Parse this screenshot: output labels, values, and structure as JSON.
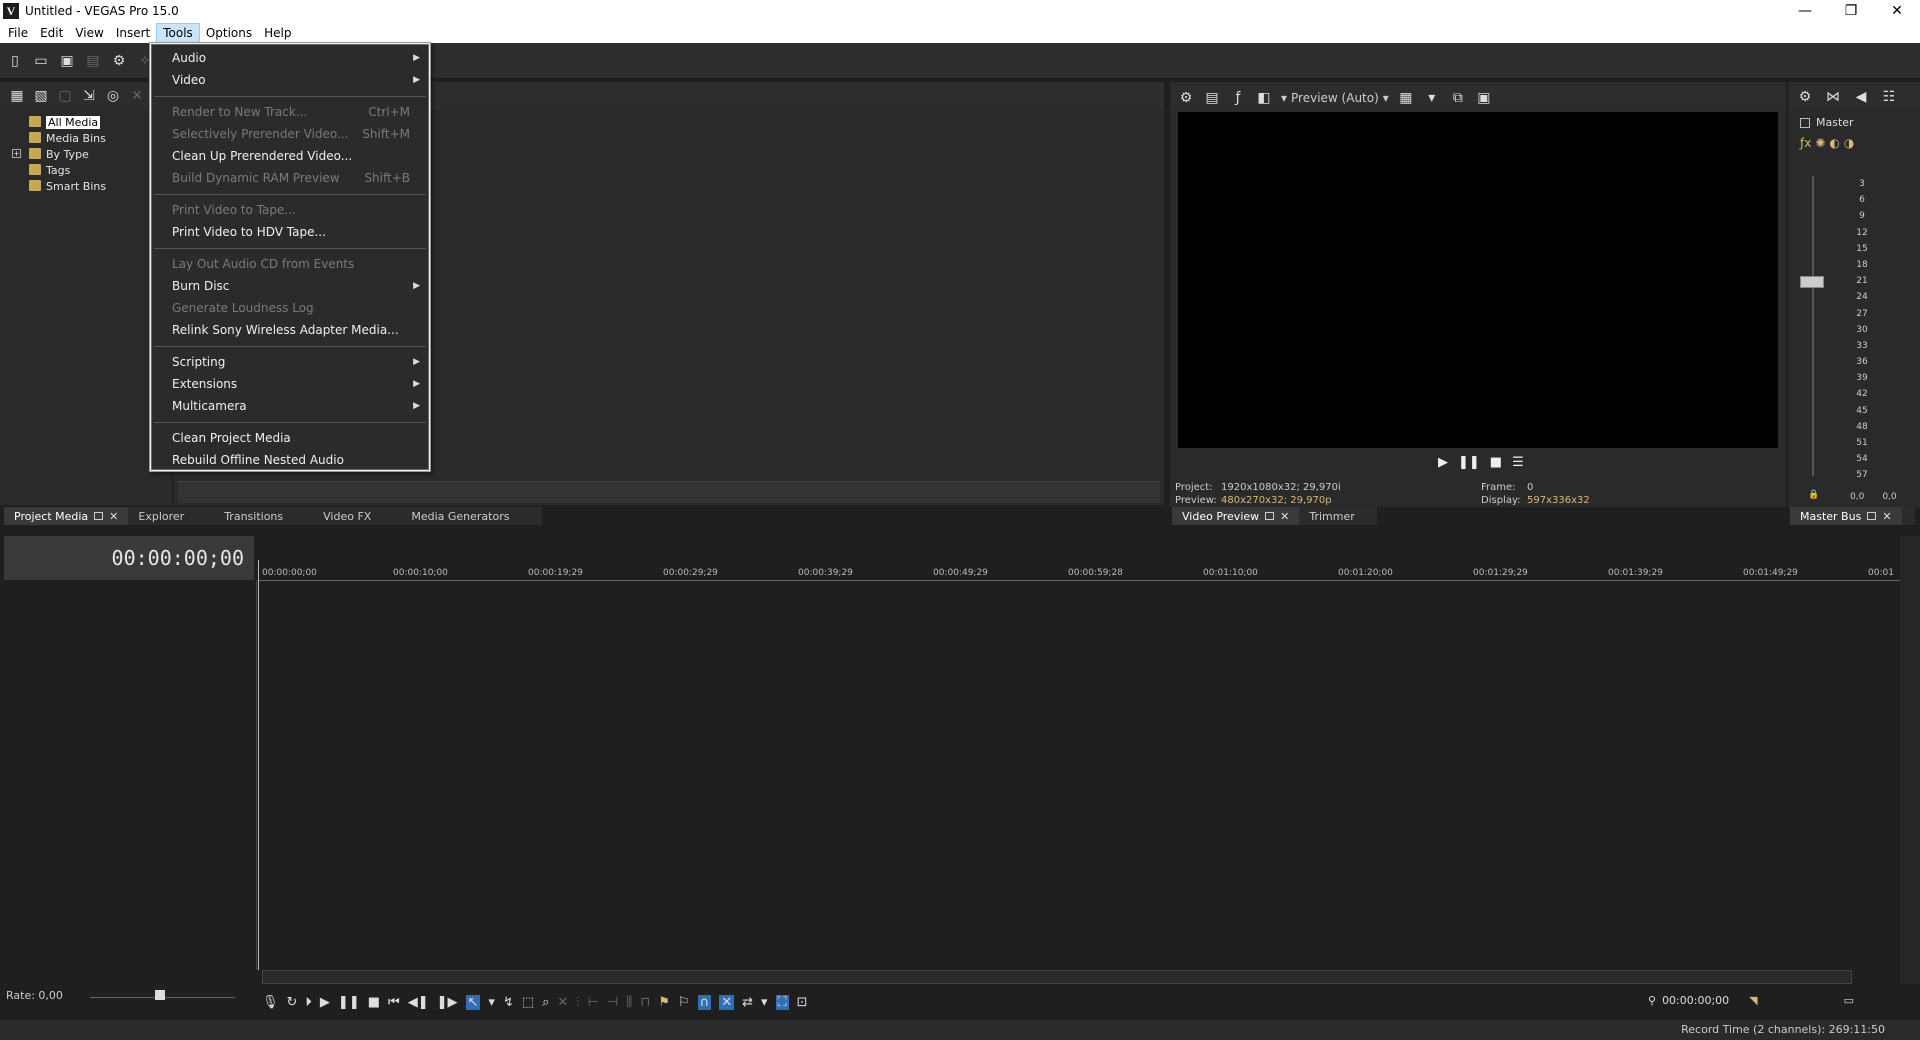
{
  "window": {
    "title": "Untitled - VEGAS Pro 15.0",
    "logo": "V",
    "minimize": "—",
    "maximize": "❐",
    "close": "✕"
  },
  "menubar": [
    "File",
    "Edit",
    "View",
    "Insert",
    "Tools",
    "Options",
    "Help"
  ],
  "tools_menu": {
    "groups": [
      [
        {
          "label": "Audio",
          "shortcut": "",
          "submenu": true,
          "disabled": false
        },
        {
          "label": "Video",
          "shortcut": "",
          "submenu": true,
          "disabled": false
        }
      ],
      [
        {
          "label": "Render to New Track...",
          "shortcut": "Ctrl+M",
          "submenu": false,
          "disabled": true
        },
        {
          "label": "Selectively Prerender Video...",
          "shortcut": "Shift+M",
          "submenu": false,
          "disabled": true
        },
        {
          "label": "Clean Up Prerendered Video...",
          "shortcut": "",
          "submenu": false,
          "disabled": false
        },
        {
          "label": "Build Dynamic RAM Preview",
          "shortcut": "Shift+B",
          "submenu": false,
          "disabled": true
        }
      ],
      [
        {
          "label": "Print Video to Tape...",
          "shortcut": "",
          "submenu": false,
          "disabled": true
        },
        {
          "label": "Print Video to HDV Tape...",
          "shortcut": "",
          "submenu": false,
          "disabled": false
        }
      ],
      [
        {
          "label": "Lay Out Audio CD from Events",
          "shortcut": "",
          "submenu": false,
          "disabled": true
        },
        {
          "label": "Burn Disc",
          "shortcut": "",
          "submenu": true,
          "disabled": false
        },
        {
          "label": "Generate Loudness Log",
          "shortcut": "",
          "submenu": false,
          "disabled": true
        },
        {
          "label": "Relink Sony Wireless Adapter Media...",
          "shortcut": "",
          "submenu": false,
          "disabled": false
        }
      ],
      [
        {
          "label": "Scripting",
          "shortcut": "",
          "submenu": true,
          "disabled": false
        },
        {
          "label": "Extensions",
          "shortcut": "",
          "submenu": true,
          "disabled": false
        },
        {
          "label": "Multicamera",
          "shortcut": "",
          "submenu": true,
          "disabled": false
        }
      ],
      [
        {
          "label": "Clean Project Media",
          "shortcut": "",
          "submenu": false,
          "disabled": false
        },
        {
          "label": "Rebuild Offline Nested Audio",
          "shortcut": "",
          "submenu": false,
          "disabled": false
        }
      ]
    ]
  },
  "project_media": {
    "tree": [
      {
        "label": "All Media",
        "selected": true,
        "expand": false
      },
      {
        "label": "Media Bins",
        "selected": false,
        "expand": false
      },
      {
        "label": "By Type",
        "selected": false,
        "expand": true
      },
      {
        "label": "Tags",
        "selected": false,
        "expand": false
      },
      {
        "label": "Smart Bins",
        "selected": false,
        "expand": false
      }
    ]
  },
  "left_tabs": [
    "Project Media",
    "Explorer",
    "Transitions",
    "Video FX",
    "Media Generators"
  ],
  "preview": {
    "mode": "Preview (Auto)",
    "project_label": "Project:",
    "project_value": "1920x1080x32; 29,970i",
    "preview_label": "Preview:",
    "preview_value": "480x270x32; 29,970p",
    "frame_label": "Frame:",
    "frame_value": "0",
    "display_label": "Display:",
    "display_value": "597x336x32",
    "tabs": [
      "Video Preview",
      "Trimmer"
    ]
  },
  "master": {
    "label": "Master",
    "scale": [
      "3",
      "6",
      "9",
      "12",
      "15",
      "18",
      "21",
      "24",
      "27",
      "30",
      "33",
      "36",
      "39",
      "42",
      "45",
      "48",
      "51",
      "54",
      "57"
    ],
    "left_val": "0,0",
    "right_val": "0,0",
    "tab": "Master Bus"
  },
  "timeline": {
    "timecode": "00:00:00;00",
    "ruler": [
      "00:00:00;00",
      "00:00:10;00",
      "00:00:19;29",
      "00:00:29;29",
      "00:00:39;29",
      "00:00:49;29",
      "00:00:59;28",
      "00:01:10;00",
      "00:01:20;00",
      "00:01:29;29",
      "00:01:39;29",
      "00:01:49;29",
      "00:01"
    ],
    "rate": "Rate: 0,00",
    "bottom_time": "00:00:00;00"
  },
  "status": {
    "record_time": "Record Time (2 channels): 269:11:50"
  },
  "colors": {
    "accent": "#2f6fb8",
    "value_text": "#d8b87a",
    "menu_highlight": "#cce4f7"
  }
}
